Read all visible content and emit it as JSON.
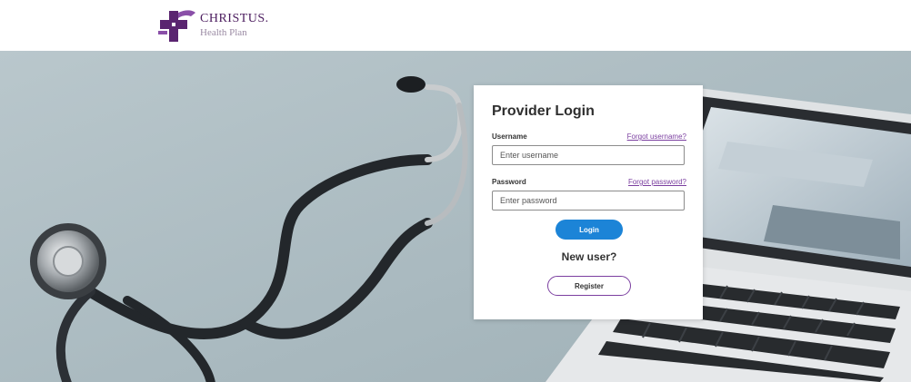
{
  "brand": {
    "name": "CHRISTUS.",
    "subtitle": "Health Plan",
    "logo_icon": "christus-cross-logo",
    "primary_color": "#4b1c5e",
    "accent_color": "#7b3fa0"
  },
  "hero": {
    "image_description_icon": "stethoscope-laptop-photo"
  },
  "login": {
    "title": "Provider Login",
    "username": {
      "label": "Username",
      "forgot_link": "Forgot username?",
      "placeholder": "Enter username",
      "value": ""
    },
    "password": {
      "label": "Password",
      "forgot_link": "Forgot password?",
      "placeholder": "Enter password",
      "value": ""
    },
    "login_button": "Login",
    "new_user_text": "New user?",
    "register_button": "Register",
    "button_color": "#1c84d7"
  }
}
